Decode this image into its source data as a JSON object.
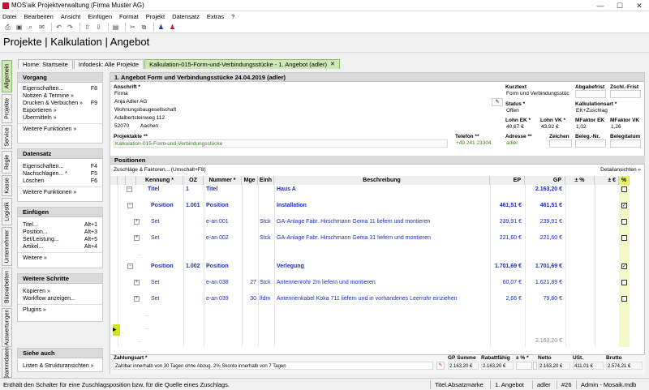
{
  "window": {
    "title": "MOS'aik Projektverwaltung (Firma Muster AG)"
  },
  "menu": [
    "Datei",
    "Bearbeiten",
    "Ansicht",
    "Einfügen",
    "Format",
    "Projekt",
    "Datensatz",
    "Extras",
    "?"
  ],
  "header": {
    "title": "Projekte | Kalkulation | Angebot"
  },
  "tabs": [
    {
      "label": "Home: Startseite"
    },
    {
      "label": "Infodesk: Alle Projekte"
    },
    {
      "label": "Kalkulation-015-Form-und-Verbindungsstücke - 1. Angebot (adler)"
    }
  ],
  "vtabs": [
    "Allgemein",
    "Projekte",
    "Service",
    "Regie",
    "Kasse",
    "Logistik",
    "Unternehmer",
    "Büroarbeiten",
    "Auswertungen",
    "Stammdaten"
  ],
  "left": {
    "vorgang": {
      "title": "Vorgang",
      "items": [
        {
          "label": "Eigenschaften...",
          "key": "F8"
        },
        {
          "label": "Notizen & Termine »",
          "key": ""
        },
        {
          "label": "Drucken & Verbuchen »",
          "key": "F9"
        },
        {
          "label": "Exportieren »",
          "key": ""
        },
        {
          "label": "Übermitteln »",
          "key": ""
        }
      ],
      "more": "Weitere Funktionen »"
    },
    "datensatz": {
      "title": "Datensatz",
      "items": [
        {
          "label": "Eigenschaften...",
          "key": "F4"
        },
        {
          "label": "Nachschlagen... *",
          "key": "F5"
        },
        {
          "label": "Löschen",
          "key": "F6"
        }
      ],
      "more": "Weitere Funktionen »"
    },
    "einfuegen": {
      "title": "Einfügen",
      "items": [
        {
          "label": "Titel...",
          "key": "Alt+1"
        },
        {
          "label": "Position...",
          "key": "Alt+3"
        },
        {
          "label": "Set/Leistung...",
          "key": "Alt+5"
        },
        {
          "label": "Artikel...",
          "key": "Alt+4"
        }
      ],
      "more": "Weitere »"
    },
    "schritte": {
      "title": "Weitere Schritte",
      "items": [
        {
          "label": "Kopieren »",
          "key": ""
        },
        {
          "label": "Workflow anzeigen...",
          "key": ""
        }
      ],
      "more": "Plugins »"
    },
    "siehe": {
      "title": "Siehe auch",
      "items": [
        {
          "label": "Listen & Strukturansichten »",
          "key": ""
        }
      ]
    }
  },
  "doc": {
    "title": "1. Angebot Form und Verbindungsstücke 24.04.2019 (adler)",
    "anschrift_label": "Anschrift *",
    "anschrift": [
      "Firma",
      "Anja Adler AG",
      "Wohnungsbaugesellschaft",
      "Adalbertsteinweg 112"
    ],
    "plz": "52070",
    "ort": "Aachen",
    "kurztext_label": "Kurztext",
    "kurztext": "Form und Verbindungsstüc",
    "abgabefrist_label": "Abgabefrist",
    "zschl_label": "Zschl.-Frist",
    "status_label": "Status *",
    "status": "Offen",
    "kalkart_label": "Kalkulationsart *",
    "kalkart": "EK+Zuschlag",
    "lohnek_label": "Lohn EK *",
    "lohnek": "40,67 €",
    "lohnvk_label": "Lohn VK *",
    "lohnvk": "43,92 €",
    "mfek_label": "MFaktor EK",
    "mfek": "1,02",
    "mfvk_label": "MFaktor VK",
    "mfvk": "1,26",
    "projektakte_label": "Projektakte **",
    "projektakte": "Kalkulation-015-Form-und-Verbindungsstücke",
    "telefon_label": "Telefon **",
    "telefon": "+49 241 23304",
    "adresse_label": "Adresse **",
    "adresse": "adler",
    "zeichen_label": "Zeichen",
    "beleg_label": "Beleg.-Nr.",
    "belegdatum_label": "Belegdatum"
  },
  "positions": {
    "title": "Positionen",
    "toolbar": "Zuschläge & Faktoren... (Umschalt+F8)",
    "detail": "Detailansichten »",
    "headers": [
      "Kennung *",
      "OZ",
      "Nummer *",
      "Mge",
      "Einh",
      "Beschreibung",
      "EP",
      "GP",
      "± %",
      "± €",
      "%"
    ],
    "rows": [
      {
        "kennung": "Titel",
        "oz": "1",
        "nummer": "Titel",
        "mge": "",
        "einh": "",
        "beschr": "Haus A",
        "ep": "",
        "gp": "2.163,20 €",
        "style": "title",
        "chk": ""
      },
      {
        "kennung": "Position",
        "oz": "1.001",
        "nummer": "Position",
        "mge": "",
        "einh": "",
        "beschr": "Installation",
        "ep": "461,51 €",
        "gp": "461,51 €",
        "style": "pos",
        "chk": "✓"
      },
      {
        "kennung": "Set",
        "oz": "",
        "nummer": "e-an 001",
        "mge": "",
        "einh": "Stck",
        "beschr": "GA-Anlage Fabr. Hirschmann Gema 11 liefern und montieren",
        "ep": "239,91 €",
        "gp": "239,91 €",
        "style": "set",
        "chk": ""
      },
      {
        "kennung": "Set",
        "oz": "",
        "nummer": "e-an 002",
        "mge": "",
        "einh": "Stck",
        "beschr": "GA-Anlage Fabr. Hirschmann Gema 31 liefern und montieren",
        "ep": "221,60 €",
        "gp": "221,60 €",
        "style": "set",
        "chk": ""
      },
      {
        "kennung": "Position",
        "oz": "1.002",
        "nummer": "Position",
        "mge": "",
        "einh": "",
        "beschr": "Verlegung",
        "ep": "1.701,69 €",
        "gp": "1.701,69 €",
        "style": "pos",
        "chk": "✓"
      },
      {
        "kennung": "Set",
        "oz": "",
        "nummer": "e-an 038",
        "mge": "27",
        "einh": "Stck",
        "beschr": "Antennenrohr 2m liefern und montieren",
        "ep": "60,07 €",
        "gp": "1.621,89 €",
        "style": "set",
        "chk": ""
      },
      {
        "kennung": "Set",
        "oz": "",
        "nummer": "e-an 039",
        "mge": "30",
        "einh": "lfdm",
        "beschr": "Antennenkabel Koka 711 liefern und in vorhandenes Leerrohr einziehen",
        "ep": "2,66 €",
        "gp": "79,80 €",
        "style": "set",
        "chk": ""
      }
    ],
    "total": "2.163,20 €"
  },
  "footer": {
    "zahlungsart_label": "Zahlungsart *",
    "zahlungsart": "Zahlbar innerhalb von 30 Tagen ohne Abzug. 2% Skonto innerhalb von 7 Tagen",
    "gpsumme_label": "GP Summe",
    "gpsumme": "2.163,20 €",
    "rabatt_label": "Rabattfähig",
    "rabatt": "2.163,20 €",
    "pct_label": "± % *",
    "netto_label": "Netto",
    "netto": "2.163,20 €",
    "ust_label": "USt.",
    "ust": "411,01 €",
    "brutto_label": "Brutto",
    "brutto": "2.574,21 €"
  },
  "status": {
    "message": "Enthält den Schalter für eine Zuschlagsposition bzw. für die Quelle eines Zuschlags.",
    "field": "Titel.Absatzmarke",
    "doc": "1. Angebot",
    "user": "adler",
    "num": "#26",
    "db": "Admin - Mosaik.mdb"
  }
}
